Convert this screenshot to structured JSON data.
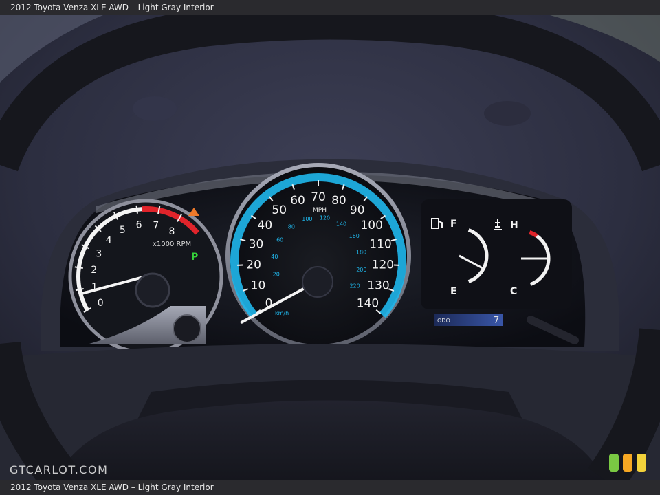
{
  "caption": {
    "top": "2012 Toyota Venza XLE AWD – Light Gray Interior",
    "bottom": "2012 Toyota Venza XLE AWD – Light Gray Interior"
  },
  "watermark": "GTCARLOT.COM",
  "tachometer": {
    "ticks": [
      "0",
      "1",
      "2",
      "3",
      "4",
      "5",
      "6",
      "7",
      "8"
    ],
    "unit": "x1000 RPM",
    "gear": "P",
    "needle_value": 0.8
  },
  "speedometer": {
    "mph_ticks": [
      "0",
      "10",
      "20",
      "30",
      "40",
      "50",
      "60",
      "70",
      "80",
      "90",
      "100",
      "110",
      "120",
      "130",
      "140"
    ],
    "mph_unit": "MPH",
    "kmh_ticks": [
      "20",
      "40",
      "60",
      "80",
      "100",
      "120",
      "140",
      "160",
      "180",
      "200",
      "220"
    ],
    "kmh_unit": "km/h",
    "needle_value": 0
  },
  "fuel": {
    "full": "F",
    "empty": "E",
    "level": 0.3
  },
  "temperature": {
    "hot": "H",
    "cold": "C",
    "level": 0.5
  },
  "odometer": {
    "label": "ODO",
    "value": "7"
  },
  "colors": {
    "speed_ring": "#1fb7ec",
    "redline": "#e0242b",
    "gear_indicator": "#35d23a",
    "badge_green": "#7ac943",
    "badge_orange": "#f7a823",
    "badge_yellow": "#f3d23b"
  }
}
